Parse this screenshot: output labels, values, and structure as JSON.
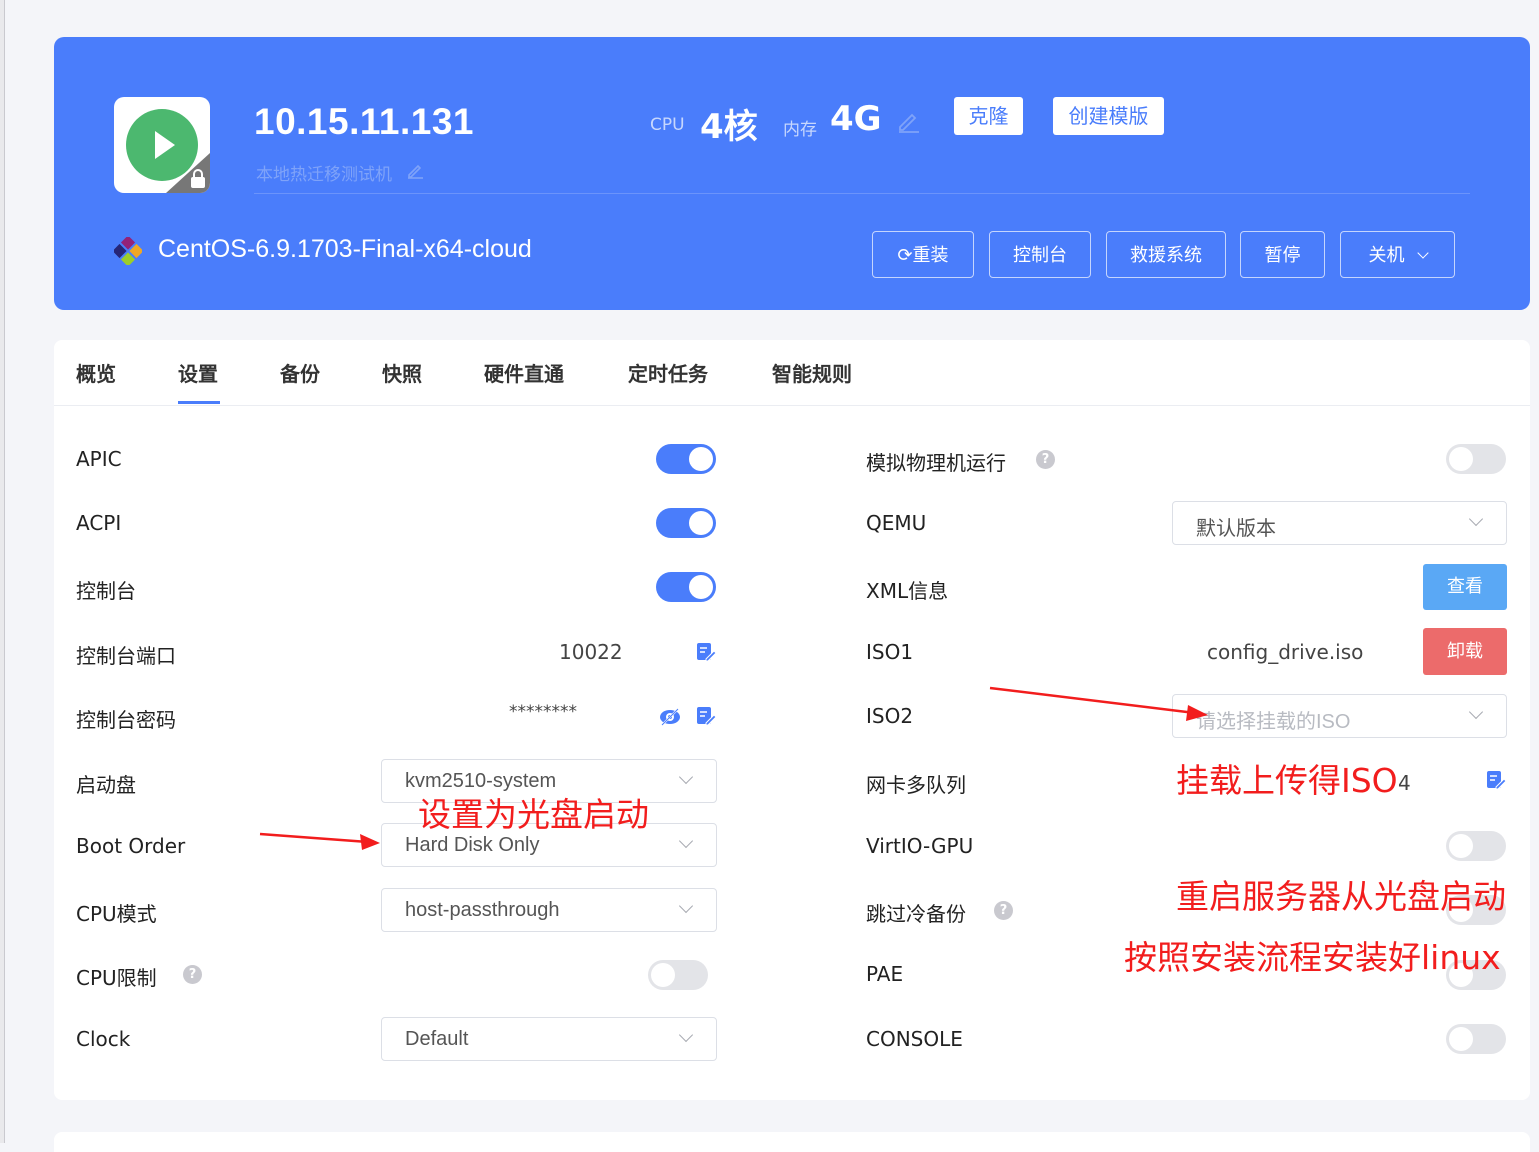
{
  "header": {
    "ip": "10.15.11.131",
    "description": "本地热迁移测试机",
    "cpu_label": "CPU",
    "cpu_value": "4核",
    "mem_label": "内存",
    "mem_value": "4G",
    "clone_button": "克隆",
    "create_template_button": "创建模版",
    "os_name": "CentOS-6.9.1703-Final-x64-cloud",
    "actions": {
      "reinstall": "重装",
      "console": "控制台",
      "rescue": "救援系统",
      "pause": "暂停",
      "shutdown": "关机"
    }
  },
  "tabs": [
    "概览",
    "设置",
    "备份",
    "快照",
    "硬件直通",
    "定时任务",
    "智能规则"
  ],
  "active_tab": "设置",
  "left_settings": {
    "apic": {
      "label": "APIC",
      "on": true
    },
    "acpi": {
      "label": "ACPI",
      "on": true
    },
    "console": {
      "label": "控制台",
      "on": true
    },
    "console_port": {
      "label": "控制台端口",
      "value": "10022"
    },
    "console_password": {
      "label": "控制台密码",
      "value": "********"
    },
    "boot_disk": {
      "label": "启动盘",
      "value": "kvm2510-system"
    },
    "boot_order": {
      "label": "Boot Order",
      "value": "Hard Disk Only"
    },
    "cpu_mode": {
      "label": "CPU模式",
      "value": "host-passthrough"
    },
    "cpu_limit": {
      "label": "CPU限制",
      "on": false
    },
    "clock": {
      "label": "Clock",
      "value": "Default"
    }
  },
  "right_settings": {
    "simulate_physical": {
      "label": "模拟物理机运行",
      "on": false
    },
    "qemu": {
      "label": "QEMU",
      "value": "默认版本"
    },
    "xml_info": {
      "label": "XML信息",
      "button": "查看"
    },
    "iso1": {
      "label": "ISO1",
      "value": "config_drive.iso",
      "button": "卸载"
    },
    "iso2": {
      "label": "ISO2",
      "placeholder": "请选择挂载的ISO"
    },
    "nic_multiqueue": {
      "label": "网卡多队列",
      "value": "4"
    },
    "virtio_gpu": {
      "label": "VirtIO-GPU",
      "on": false
    },
    "skip_cold_backup": {
      "label": "跳过冷备份",
      "on": false
    },
    "pae": {
      "label": "PAE",
      "on": false
    },
    "console_switch": {
      "label": "CONSOLE",
      "on": false
    }
  },
  "annotations": {
    "boot_from_cd": "设置为光盘启动",
    "mount_iso": "挂载上传得ISO",
    "reboot": "重启服务器从光盘启动",
    "install": "按照安装流程安装好linux"
  },
  "colors": {
    "primary": "#4a7dfb",
    "success": "#4cb86f",
    "info": "#5aa8f5",
    "danger": "#ec6b6b",
    "annotation": "#f21d1d"
  }
}
